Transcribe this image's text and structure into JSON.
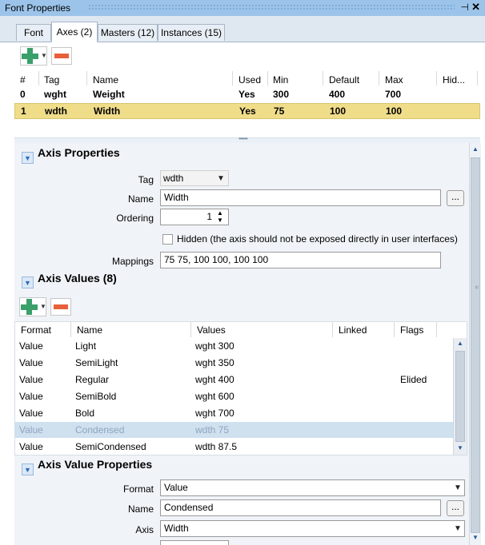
{
  "window": {
    "title": "Font Properties",
    "pin_glyph": "⊣",
    "close_glyph": "✕"
  },
  "tabs": [
    {
      "label": "Font"
    },
    {
      "label": "Axes (2)"
    },
    {
      "label": "Masters (12)"
    },
    {
      "label": "Instances (15)"
    }
  ],
  "axes_table": {
    "columns": [
      "#",
      "Tag",
      "Name",
      "Used",
      "Min",
      "Default",
      "Max",
      "Hid..."
    ],
    "rows": [
      {
        "index": "0",
        "tag": "wght",
        "name": "Weight",
        "used": "Yes",
        "min": "300",
        "default": "400",
        "max": "700"
      },
      {
        "index": "1",
        "tag": "wdth",
        "name": "Width",
        "used": "Yes",
        "min": "75",
        "default": "100",
        "max": "100"
      }
    ]
  },
  "axis_properties": {
    "title": "Axis Properties",
    "tag_label": "Tag",
    "tag_value": "wdth",
    "name_label": "Name",
    "name_value": "Width",
    "ordering_label": "Ordering",
    "ordering_value": "1",
    "hidden_label": "Hidden (the axis should not be exposed directly in user interfaces)",
    "mappings_label": "Mappings",
    "mappings_value": "75 75, 100 100, 100 100"
  },
  "axis_values": {
    "title": "Axis Values (8)",
    "columns": [
      "Format",
      "Name",
      "Values",
      "Linked",
      "Flags"
    ],
    "rows": [
      {
        "format": "Value",
        "name": "Light",
        "values": "wght 300",
        "linked": "",
        "flags": ""
      },
      {
        "format": "Value",
        "name": "SemiLight",
        "values": "wght 350",
        "linked": "",
        "flags": ""
      },
      {
        "format": "Value",
        "name": "Regular",
        "values": "wght 400",
        "linked": "",
        "flags": "Elided"
      },
      {
        "format": "Value",
        "name": "SemiBold",
        "values": "wght 600",
        "linked": "",
        "flags": ""
      },
      {
        "format": "Value",
        "name": "Bold",
        "values": "wght 700",
        "linked": "",
        "flags": ""
      },
      {
        "format": "Value",
        "name": "Condensed",
        "values": "wdth 75",
        "linked": "",
        "flags": ""
      },
      {
        "format": "Value",
        "name": "SemiCondensed",
        "values": "wdth 87.5",
        "linked": "",
        "flags": ""
      }
    ]
  },
  "axis_value_properties": {
    "title": "Axis Value Properties",
    "format_label": "Format",
    "format_value": "Value",
    "name_label": "Name",
    "name_value": "Condensed",
    "axis_label": "Axis",
    "axis_value": "Width"
  },
  "buttons": {
    "browse_label": "..."
  },
  "icons": {
    "add": "plus-icon",
    "remove": "minus-icon",
    "collapse": "chevron-down-icon"
  },
  "colors": {
    "accent_green": "#3aa06b",
    "remove_red": "#e8603a",
    "selected_row": "#f0dd8a",
    "selected_value_row": "#cfe0ef",
    "title_bar": "#9cc4ea"
  }
}
